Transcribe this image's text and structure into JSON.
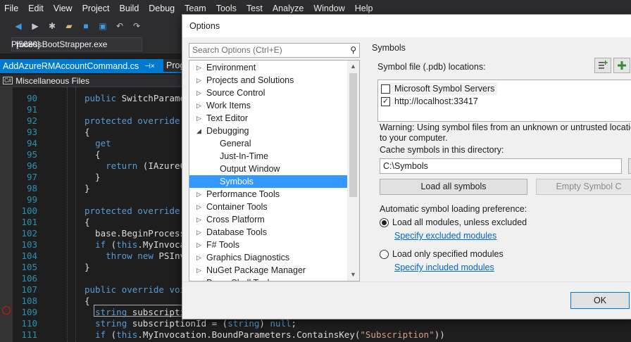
{
  "menu": [
    "File",
    "Edit",
    "View",
    "Project",
    "Build",
    "Debug",
    "Team",
    "Tools",
    "Test",
    "Analyze",
    "Window",
    "Help"
  ],
  "process": {
    "label": "Process:",
    "value": "[5680] BootStrapper.exe"
  },
  "tabs": {
    "active": "AddAzureRMAccountCommand.cs",
    "pin": "⊣×",
    "other": "Prog"
  },
  "navbar": {
    "badge": "C#",
    "project": "Miscellaneous Files"
  },
  "code_lines": [
    {
      "num": "90",
      "text": "public SwitchParamet"
    },
    {
      "num": "91",
      "text": ""
    },
    {
      "num": "92",
      "text": "protected override I"
    },
    {
      "num": "93",
      "text": "{"
    },
    {
      "num": "94",
      "text": "  get"
    },
    {
      "num": "95",
      "text": "  {"
    },
    {
      "num": "96",
      "text": "    return (IAzureCo"
    },
    {
      "num": "97",
      "text": "  }"
    },
    {
      "num": "98",
      "text": "}"
    },
    {
      "num": "99",
      "text": ""
    },
    {
      "num": "100",
      "text": "protected override vo"
    },
    {
      "num": "101",
      "text": "{"
    },
    {
      "num": "102",
      "text": "  base.BeginProcessi"
    },
    {
      "num": "103",
      "text": "  if (this.MyInvocat"
    },
    {
      "num": "104",
      "text": "    throw new PSInva"
    },
    {
      "num": "105",
      "text": "}"
    },
    {
      "num": "106",
      "text": ""
    },
    {
      "num": "107",
      "text": "public override void"
    },
    {
      "num": "108",
      "text": "{"
    },
    {
      "num": "109",
      "text": "  string subscriptio"
    },
    {
      "num": "110",
      "text": "  string subscriptionId = (string) null;"
    },
    {
      "num": "111",
      "text": "  if (this.MyInvocation.BoundParameters.ContainsKey(\"Subscription\"))"
    }
  ],
  "dialog": {
    "title": "Options",
    "search_placeholder": "Search Options (Ctrl+E)",
    "tree": [
      {
        "label": "Environment",
        "level": 0,
        "expandable": true,
        "expanded": false
      },
      {
        "label": "Projects and Solutions",
        "level": 0,
        "expandable": true,
        "expanded": false
      },
      {
        "label": "Source Control",
        "level": 0,
        "expandable": true,
        "expanded": false
      },
      {
        "label": "Work Items",
        "level": 0,
        "expandable": true,
        "expanded": false
      },
      {
        "label": "Text Editor",
        "level": 0,
        "expandable": true,
        "expanded": false
      },
      {
        "label": "Debugging",
        "level": 0,
        "expandable": true,
        "expanded": true
      },
      {
        "label": "General",
        "level": 1,
        "expandable": false
      },
      {
        "label": "Just-In-Time",
        "level": 1,
        "expandable": false
      },
      {
        "label": "Output Window",
        "level": 1,
        "expandable": false
      },
      {
        "label": "Symbols",
        "level": 1,
        "expandable": false,
        "selected": true
      },
      {
        "label": "Performance Tools",
        "level": 0,
        "expandable": true,
        "expanded": false
      },
      {
        "label": "Container Tools",
        "level": 0,
        "expandable": true,
        "expanded": false
      },
      {
        "label": "Cross Platform",
        "level": 0,
        "expandable": true,
        "expanded": false
      },
      {
        "label": "Database Tools",
        "level": 0,
        "expandable": true,
        "expanded": false
      },
      {
        "label": "F# Tools",
        "level": 0,
        "expandable": true,
        "expanded": false
      },
      {
        "label": "Graphics Diagnostics",
        "level": 0,
        "expandable": true,
        "expanded": false
      },
      {
        "label": "NuGet Package Manager",
        "level": 0,
        "expandable": true,
        "expanded": false
      },
      {
        "label": "PowerShell Tools",
        "level": 0,
        "expandable": true,
        "expanded": false
      }
    ],
    "section_title": "Symbols",
    "locations_label": "Symbol file (.pdb) locations:",
    "locations": [
      {
        "label": "Microsoft Symbol Servers",
        "checked": false
      },
      {
        "label": "http://localhost:33417",
        "checked": true
      }
    ],
    "warning_line1": "Warning: Using symbol files from an unknown or untrusted location",
    "warning_line2": "to your computer.",
    "cache_label": "Cache symbols in this directory:",
    "cache_value": "C:\\Symbols",
    "load_all_button": "Load all symbols",
    "empty_cache_button": "Empty Symbol C",
    "pref_label": "Automatic symbol loading preference:",
    "radio_all": "Load all modules, unless excluded",
    "link_excluded": "Specify excluded modules",
    "radio_specified": "Load only specified modules",
    "link_included": "Specify included modules",
    "ok_button": "OK"
  },
  "colors": {
    "accent": "#007acc",
    "selection": "#3399ff",
    "ide_bg": "#1e1e1e",
    "chrome": "#2d2d30",
    "link": "#0066cc"
  }
}
